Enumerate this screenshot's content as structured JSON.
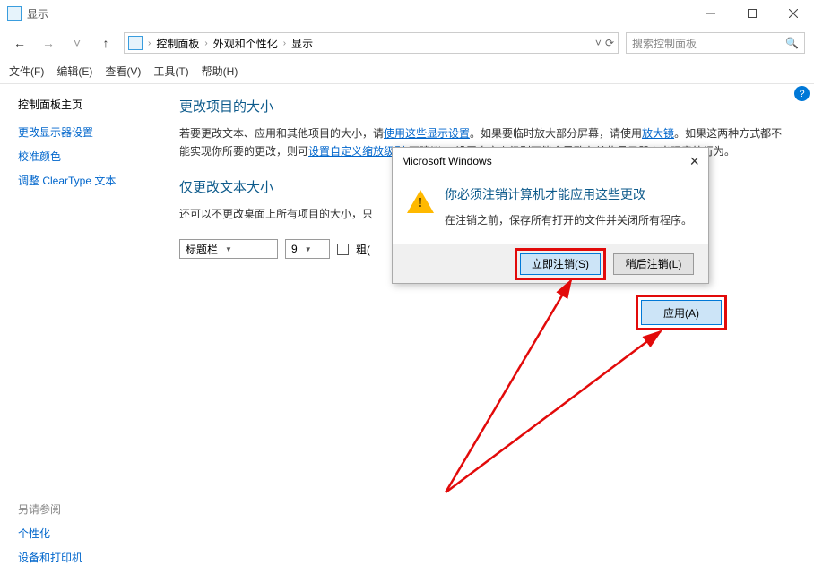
{
  "window": {
    "title": "显示"
  },
  "breadcrumb": {
    "items": [
      "控制面板",
      "外观和个性化",
      "显示"
    ]
  },
  "search": {
    "placeholder": "搜索控制面板"
  },
  "menu": {
    "items": [
      "文件(F)",
      "编辑(E)",
      "查看(V)",
      "工具(T)",
      "帮助(H)"
    ]
  },
  "sidebar": {
    "home": "控制面板主页",
    "links": [
      "更改显示器设置",
      "校准颜色",
      "调整 ClearType 文本"
    ],
    "seeAlsoHeading": "另请参阅",
    "seeAlso": [
      "个性化",
      "设备和打印机"
    ]
  },
  "main": {
    "heading": "更改项目的大小",
    "para1_pre": "若要更改文本、应用和其他项目的大小，请",
    "para1_link1": "使用这些显示设置",
    "para1_mid": "。如果要临时放大部分屏幕，请使用",
    "para1_link2": "放大镜",
    "para1_post": "。如果这两种方式都不能实现你所要的更改，则可",
    "para1_link3": "设置自定义缩放级别",
    "para1_tail": "(不建议)。设置自定义级别可能会导致在某些显示器上出现意外行为。",
    "heading2": "仅更改文本大小",
    "para2": "还可以不更改桌面上所有项目的大小，只",
    "dropdown1": "标题栏",
    "dropdown2": "9",
    "checkboxLabel": "粗(",
    "applyButton": "应用(A)"
  },
  "dialog": {
    "title": "Microsoft Windows",
    "message1": "你必须注销计算机才能应用这些更改",
    "message2": "在注销之前，保存所有打开的文件并关闭所有程序。",
    "btnPrimary": "立即注销(S)",
    "btnSecondary": "稍后注销(L)"
  }
}
